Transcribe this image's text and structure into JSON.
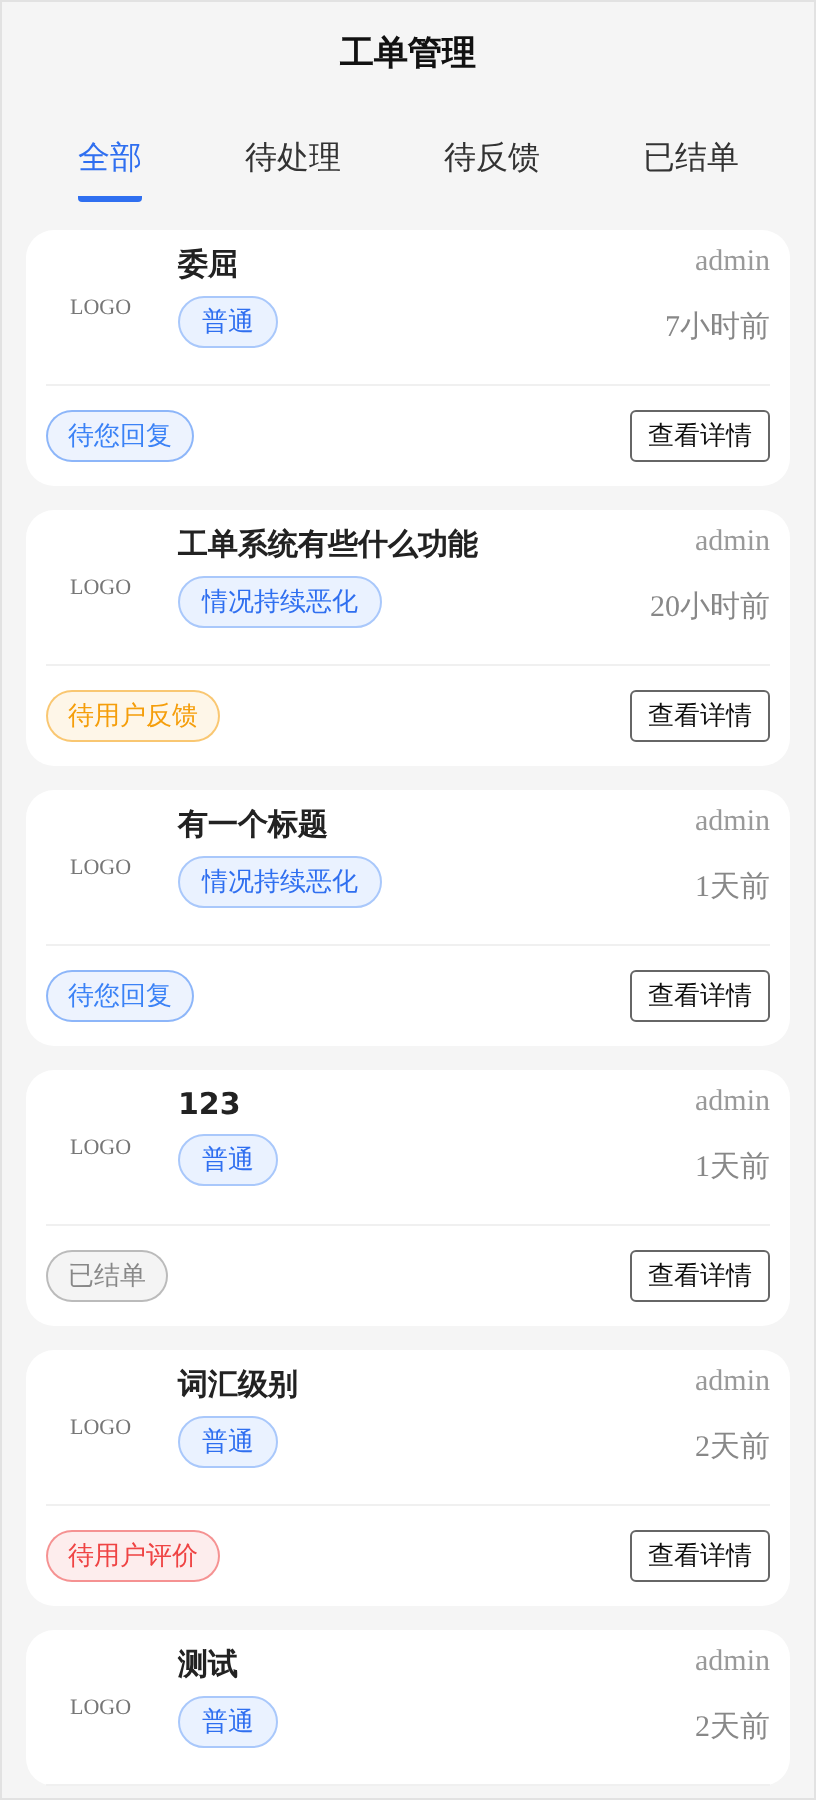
{
  "header": {
    "title": "工单管理"
  },
  "tabs": [
    {
      "label": "全部",
      "selected": true
    },
    {
      "label": "待处理",
      "selected": false
    },
    {
      "label": "待反馈",
      "selected": false
    },
    {
      "label": "已结单",
      "selected": false
    }
  ],
  "tickets": [
    {
      "logo": "LOGO",
      "title": "委屈",
      "tag": "普通",
      "author": "admin",
      "time": "7小时前",
      "status": {
        "label": "待您回复",
        "color": "#3b82f6"
      },
      "action": "查看详情"
    },
    {
      "logo": "LOGO",
      "title": "工单系统有些什么功能",
      "tag": "情况持续恶化",
      "author": "admin",
      "time": "20小时前",
      "status": {
        "label": "待用户反馈",
        "color": "#f59e0b"
      },
      "action": "查看详情"
    },
    {
      "logo": "LOGO",
      "title": "有一个标题",
      "tag": "情况持续恶化",
      "author": "admin",
      "time": "1天前",
      "status": {
        "label": "待您回复",
        "color": "#3b82f6"
      },
      "action": "查看详情"
    },
    {
      "logo": "LOGO",
      "title": "123",
      "tag": "普通",
      "author": "admin",
      "time": "1天前",
      "status": {
        "label": "已结单",
        "color": "#888888"
      },
      "action": "查看详情"
    },
    {
      "logo": "LOGO",
      "title": "词汇级别",
      "tag": "普通",
      "author": "admin",
      "time": "2天前",
      "status": {
        "label": "待用户评价",
        "color": "#ef4444"
      },
      "action": "查看详情"
    },
    {
      "logo": "LOGO",
      "title": "测试",
      "tag": "普通",
      "author": "admin",
      "time": "2天前"
    }
  ]
}
